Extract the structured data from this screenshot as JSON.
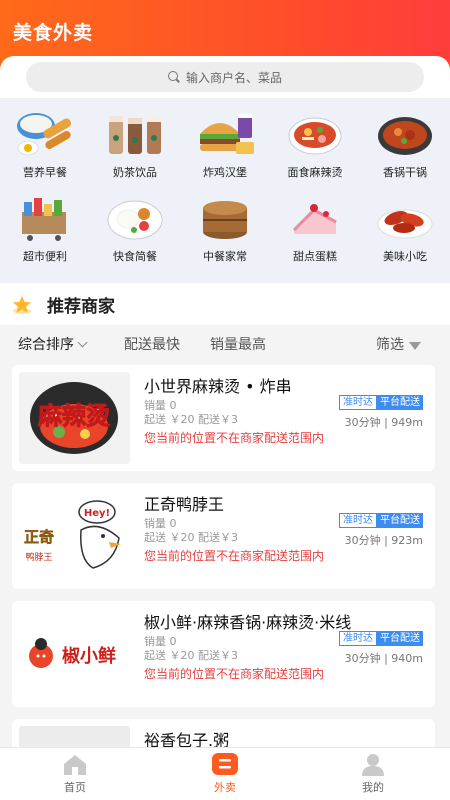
{
  "header": {
    "title": "美食外卖"
  },
  "search": {
    "placeholder": "输入商户名、菜品"
  },
  "categories": [
    {
      "label": "营养早餐",
      "icon": "breakfast-icon"
    },
    {
      "label": "奶茶饮品",
      "icon": "milk-tea-icon"
    },
    {
      "label": "炸鸡汉堡",
      "icon": "burger-icon"
    },
    {
      "label": "面食麻辣烫",
      "icon": "noodle-icon"
    },
    {
      "label": "香锅干锅",
      "icon": "dry-pot-icon"
    },
    {
      "label": "超市便利",
      "icon": "supermarket-icon"
    },
    {
      "label": "快食简餐",
      "icon": "fast-meal-icon"
    },
    {
      "label": "中餐家常",
      "icon": "chinese-food-icon"
    },
    {
      "label": "甜点蛋糕",
      "icon": "cake-icon"
    },
    {
      "label": "美味小吃",
      "icon": "snack-icon"
    }
  ],
  "section": {
    "title": "推荐商家"
  },
  "sort": {
    "default": "综合排序",
    "fastest": "配送最快",
    "sales": "销量最高",
    "filter": "筛选"
  },
  "merchants": [
    {
      "name": "小世界麻辣烫 • 炸串",
      "logo_text": "麻辣烫",
      "sales": "销量 0",
      "price": "起送 ￥20   配送￥3",
      "badge1": "准时达",
      "badge2": "平台配送",
      "distance": "30分钟 | 949m",
      "warning": "您当前的位置不在商家配送范围内"
    },
    {
      "name": "正奇鸭脖王",
      "logo_text": "正奇",
      "logo_sub": "鸭脖王",
      "logo_bubble": "Hey!",
      "sales": "销量 0",
      "price": "起送 ￥20   配送￥3",
      "badge1": "准时达",
      "badge2": "平台配送",
      "distance": "30分钟 | 923m",
      "warning": "您当前的位置不在商家配送范围内"
    },
    {
      "name": "椒小鲜·麻辣香锅·麻辣烫·米线",
      "logo_text": "椒小鲜",
      "sales": "销量 0",
      "price": "起送 ￥20   配送￥3",
      "badge1": "准时达",
      "badge2": "平台配送",
      "distance": "30分钟 | 940m",
      "warning": "您当前的位置不在商家配送范围内"
    },
    {
      "name": "裕香包子.粥"
    }
  ],
  "tabbar": {
    "home": "首页",
    "takeout": "外卖",
    "mine": "我的"
  },
  "colors": {
    "accent": "#ff5a1f",
    "blue": "#3c8cf2",
    "warning": "#e64040"
  }
}
